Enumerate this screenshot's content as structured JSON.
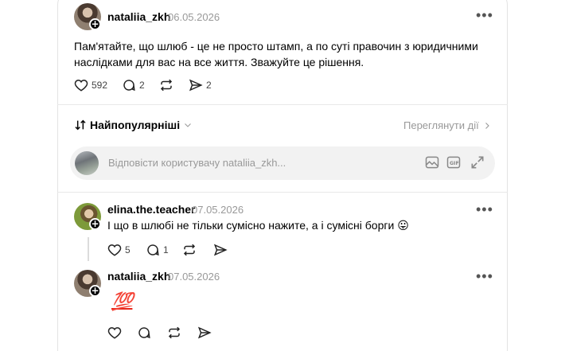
{
  "post": {
    "username": "nataliia_zkh",
    "date": "06.05.2026",
    "text_line1": "Пам'ятайте, що шлюб - це не просто штамп, а по суті правочин з юридичними",
    "text_line2": "наслідками для вас на все життя. Зважуйте це рішення.",
    "likes": "592",
    "comments": "2",
    "shares": "2"
  },
  "sort": {
    "label": "Найпопулярніші"
  },
  "view_activity": "Переглянути дії",
  "reply": {
    "placeholder": "Відповісти користувачу nataliia_zkh..."
  },
  "replies": [
    {
      "username": "elina.the.teacher",
      "date": "07.05.2026",
      "text": "І що в шлюбі не тільки сумісно нажите, а і сумісні борги 😛",
      "likes": "5",
      "comments": "1"
    },
    {
      "username": "nataliia_zkh",
      "date": "07.05.2026",
      "text": "💯"
    }
  ],
  "icons": [
    "heart-icon",
    "comment-icon",
    "repost-icon",
    "share-icon",
    "more-icon",
    "sort-icon",
    "chevron-down-icon",
    "chevron-right-icon",
    "image-icon",
    "gif-icon",
    "expand-icon"
  ]
}
